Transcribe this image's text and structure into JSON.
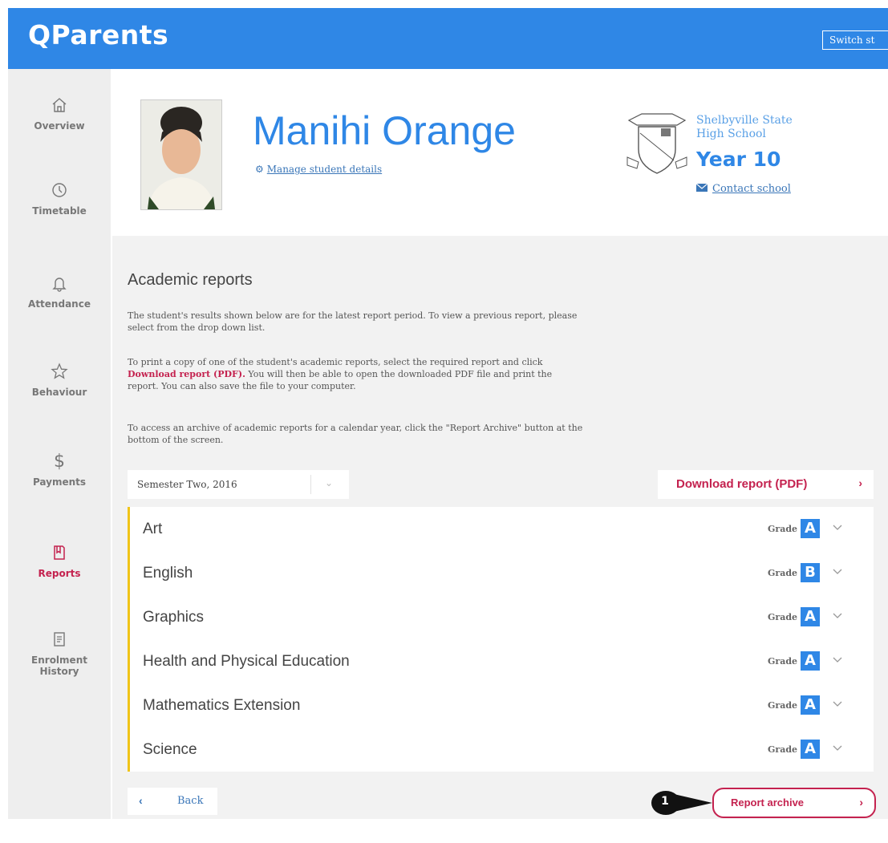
{
  "header": {
    "logo": "QParents",
    "switch_label": "Switch st"
  },
  "sidebar": {
    "items": [
      {
        "label": "Overview",
        "icon": "home-icon"
      },
      {
        "label": "Timetable",
        "icon": "clock-icon"
      },
      {
        "label": "Attendance",
        "icon": "bell-icon"
      },
      {
        "label": "Behaviour",
        "icon": "star-icon"
      },
      {
        "label": "Payments",
        "icon": "dollar-icon",
        "glyph": "$"
      },
      {
        "label": "Reports",
        "icon": "report-icon",
        "active": true
      },
      {
        "label": "Enrolment History",
        "icon": "enrolment-icon"
      }
    ]
  },
  "student": {
    "name": "Manihi Orange",
    "manage_link": "Manage student details",
    "school_name": "Shelbyville State High School",
    "year": "Year 10",
    "contact_link": "Contact school"
  },
  "reports": {
    "title": "Academic reports",
    "para1": "The student's results shown below are for the latest report period. To view a previous report, please select from the drop down list.",
    "para2_before": "To print a copy of one of the student's academic reports, select the required report and click",
    "para2_highlight": "Download report (PDF).",
    "para2_after": "You will then be able to open the downloaded PDF file and print the report. You can also save the file to your computer.",
    "para3": "To access an archive of academic reports for a calendar year, click the \"Report Archive\" button at the bottom of the screen.",
    "selected_period": "Semester Two, 2016",
    "download_label": "Download report (PDF)",
    "grade_label": "Grade",
    "subjects": [
      {
        "name": "Art",
        "grade": "A"
      },
      {
        "name": "English",
        "grade": "B"
      },
      {
        "name": "Graphics",
        "grade": "A"
      },
      {
        "name": "Health and Physical Education",
        "grade": "A"
      },
      {
        "name": "Mathematics Extension",
        "grade": "A"
      },
      {
        "name": "Science",
        "grade": "A"
      }
    ],
    "back_label": "Back",
    "archive_label": "Report archive",
    "callout_number": "1"
  },
  "colors": {
    "brand_blue": "#2f87e6",
    "accent_red": "#c4224f",
    "subject_border": "#f0c419"
  }
}
